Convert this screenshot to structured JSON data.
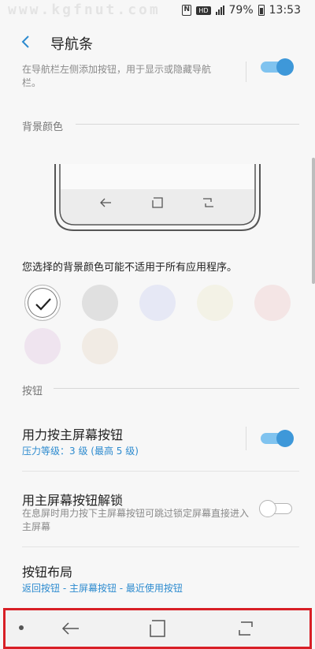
{
  "status_bar": {
    "watermark": "www.kgfnut.com",
    "nfc_glyph": "N",
    "hd_glyph": "HD",
    "battery": "79%",
    "time": "13:53"
  },
  "header": {
    "back_icon": "chevron-left-icon",
    "title": "导航条"
  },
  "hide_nav": {
    "description": "在导航栏左侧添加按钮，用于显示或隐藏导航栏。",
    "enabled": true
  },
  "background_color": {
    "section_title": "背景颜色",
    "preview_icons": [
      "back-arrow-icon",
      "home-square-icon",
      "recents-icon"
    ],
    "note": "您选择的背景颜色可能不适用于所有应用程序。",
    "swatches": [
      {
        "color": "#ffffff",
        "selected": true
      },
      {
        "color": "#e0e0e0",
        "selected": false
      },
      {
        "color": "#e6e8f5",
        "selected": false
      },
      {
        "color": "#f3f2e6",
        "selected": false
      },
      {
        "color": "#f4e5e5",
        "selected": false
      },
      {
        "color": "#efe4ef",
        "selected": false
      },
      {
        "color": "#f1ebe4",
        "selected": false
      }
    ]
  },
  "buttons": {
    "section_title": "按钮",
    "pressure": {
      "title": "用力按主屏幕按钮",
      "subtitle": "压力等级：3 级 (最高 5 级)",
      "enabled": true
    },
    "unlock": {
      "title": "用主屏幕按钮解锁",
      "description": "在息屏时用力按下主屏幕按钮可跳过锁定屏幕直接进入主屏幕",
      "enabled": false
    },
    "layout": {
      "title": "按钮布局",
      "subtitle": "返回按钮 - 主屏幕按钮 - 最近使用按钮"
    }
  },
  "nav_bar": {
    "icons": [
      "dot-icon",
      "back-arrow-icon",
      "home-square-icon",
      "recents-icon"
    ],
    "highlight_color": "#d81f26"
  },
  "colors": {
    "accent": "#3e98d9",
    "link": "#2d8bcf"
  }
}
